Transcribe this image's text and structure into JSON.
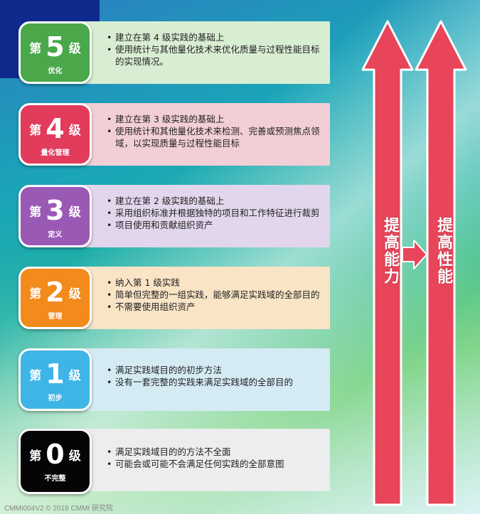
{
  "levels": [
    {
      "prefix": "第",
      "number": "5",
      "suffix": "级",
      "name": "优化",
      "color": "#4aa84a",
      "panel_color": "#d8eed3",
      "bullets": [
        "建立在第 4 级实践的基础上",
        "使用统计与其他量化技术来优化质量与过程性能目标的实现情况。"
      ]
    },
    {
      "prefix": "第",
      "number": "4",
      "suffix": "级",
      "name": "量化管理",
      "color": "#e23b5c",
      "panel_color": "#f2cfd6",
      "bullets": [
        "建立在第 3 级实践的基础上",
        "使用统计和其他量化技术来检测、完善或预测焦点领域，以实现质量与过程性能目标"
      ]
    },
    {
      "prefix": "第",
      "number": "3",
      "suffix": "级",
      "name": "定义",
      "color": "#9b59b6",
      "panel_color": "#e2d6ec",
      "bullets": [
        "建立在第 2 级实践的基础上",
        "采用组织标准并根据独特的项目和工作特征进行裁剪",
        "项目使用和贡献组织资产"
      ]
    },
    {
      "prefix": "第",
      "number": "2",
      "suffix": "级",
      "name": "管理",
      "color": "#f28a1c",
      "panel_color": "#f9e4c6",
      "bullets": [
        "纳入第 1 级实践",
        "简单但完整的一组实践，能够满足实践域的全部目的",
        "不需要使用组织资产"
      ]
    },
    {
      "prefix": "第",
      "number": "1",
      "suffix": "级",
      "name": "初步",
      "color": "#3fb4e6",
      "panel_color": "#d4ebf4",
      "bullets": [
        "满足实践域目的的初步方法",
        "没有一套完整的实践来满足实践域的全部目的"
      ]
    },
    {
      "prefix": "第",
      "number": "0",
      "suffix": "级",
      "name": "不完整",
      "color": "#050505",
      "panel_color": "#ecedee",
      "bullets": [
        "满足实践域目的的方法不全面",
        "可能会或可能不会满足任何实践的全部意图"
      ]
    }
  ],
  "arrows": {
    "left_label": "提高能力",
    "right_label": "提高性能",
    "color": "#e8455a"
  },
  "footer": "CMMI004V2 © 2018 CMMI 研究院"
}
